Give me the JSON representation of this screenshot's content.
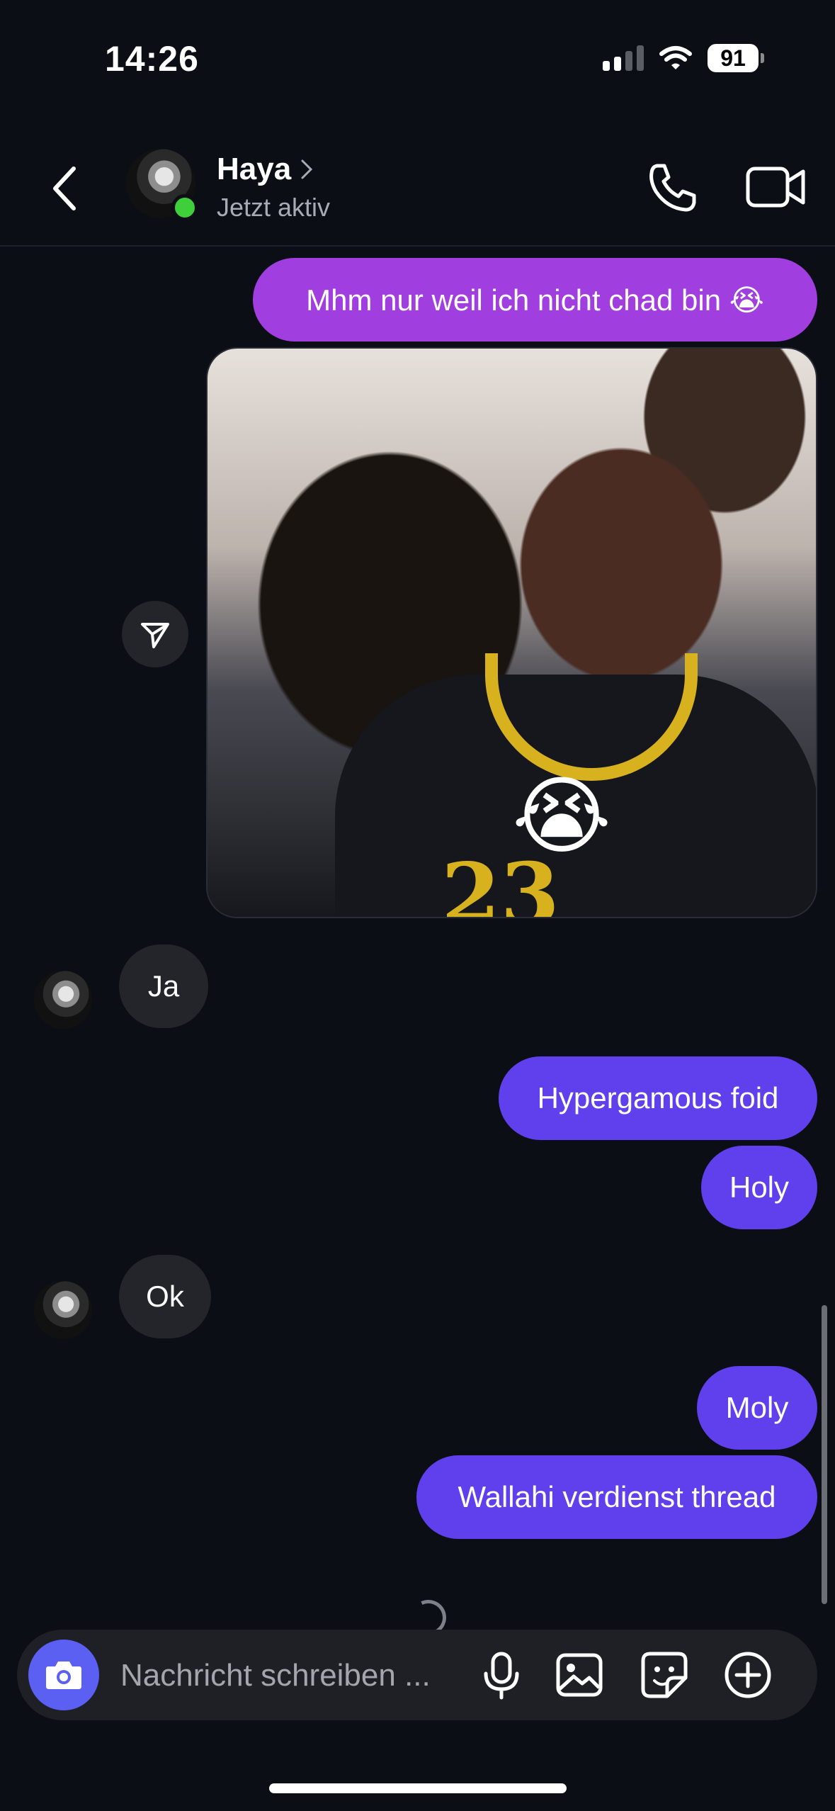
{
  "status_bar": {
    "time": "14:26",
    "battery": "91"
  },
  "header": {
    "contact_name": "Haya",
    "contact_status": "Jetzt aktiv"
  },
  "messages": [
    {
      "direction": "outgoing",
      "text": "Mhm nur weil ich nicht chad bin 😭"
    },
    {
      "direction": "outgoing",
      "type": "gif"
    },
    {
      "direction": "incoming",
      "text": "Ja"
    },
    {
      "direction": "outgoing",
      "text": "Hypergamous foid"
    },
    {
      "direction": "outgoing",
      "text": "Holy"
    },
    {
      "direction": "incoming",
      "text": "Ok"
    },
    {
      "direction": "outgoing",
      "text": "Moly"
    },
    {
      "direction": "outgoing",
      "text": "Wallahi verdienst thread"
    }
  ],
  "composer": {
    "placeholder": "Nachricht schreiben ..."
  },
  "colors": {
    "background": "#0b0e14",
    "bubble_outgoing_top": "#a03ee0",
    "bubble_outgoing": "#6040ec",
    "bubble_incoming": "#23252b",
    "online": "#3ecf3b",
    "camera_button": "#5b5ff2"
  }
}
